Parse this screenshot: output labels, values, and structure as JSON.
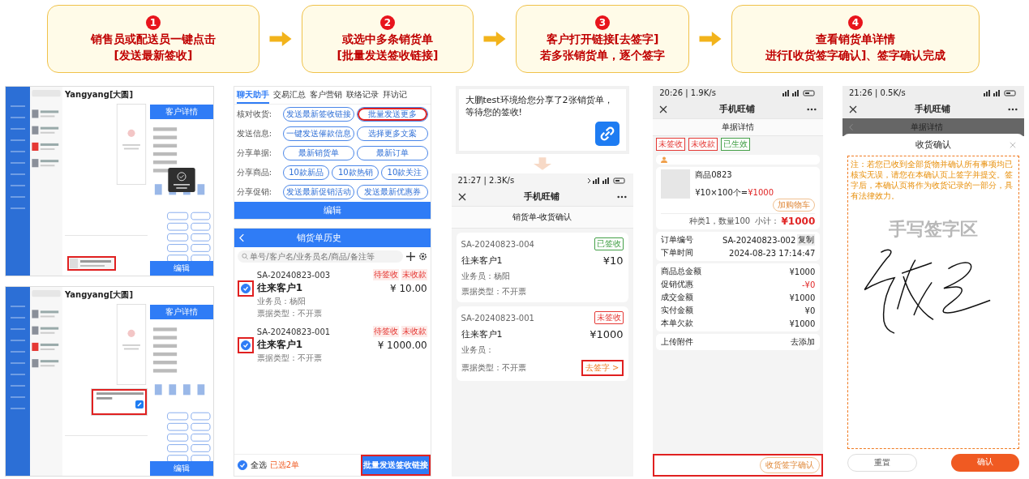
{
  "steps": [
    {
      "number": "1",
      "lines": [
        "销售员或配送员一键点击",
        "[发送最新签收]"
      ]
    },
    {
      "number": "2",
      "lines": [
        "或选中多条销货单",
        "[批量发送签收链接]"
      ]
    },
    {
      "number": "3",
      "lines": [
        "客户打开链接[去签字]",
        "若多张销货单，逐个签字"
      ]
    },
    {
      "number": "4",
      "lines": [
        "查看销货单详情",
        "进行[收货签字确认]、签字确认完成"
      ]
    }
  ],
  "desktop_screens": [
    {
      "chat_title": "Yangyang[大圆]",
      "panel_title": "客户详情",
      "edit_label": "编辑",
      "toast_shown": true,
      "card": {
        "kind": "composer",
        "highlighted": true
      }
    },
    {
      "chat_title": "Yangyang[大圆]",
      "panel_title": "客户详情",
      "edit_label": "编辑",
      "toast_shown": false,
      "card": {
        "kind": "message",
        "highlighted": true
      }
    }
  ],
  "assistant": {
    "tabs": [
      {
        "label": "聊天助手",
        "selected": true
      },
      {
        "label": "交易汇总",
        "selected": false
      },
      {
        "label": "客户营销",
        "selected": false
      },
      {
        "label": "联络记录",
        "selected": false
      },
      {
        "label": "拜访记",
        "selected": false
      }
    ],
    "rows": [
      {
        "label": "核对收货:",
        "buttons": [
          {
            "label": "发送最新签收链接",
            "highlighted": false
          },
          {
            "label": "批量发送更多",
            "highlighted": true
          }
        ]
      },
      {
        "label": "发送信息:",
        "buttons": [
          {
            "label": "一键发送催款信息",
            "highlighted": false
          },
          {
            "label": "选择更多文案",
            "highlighted": false
          }
        ]
      },
      {
        "label": "分享单据:",
        "buttons": [
          {
            "label": "最新销货单",
            "highlighted": false
          },
          {
            "label": "最新订单",
            "highlighted": false
          }
        ]
      },
      {
        "label": "分享商品:",
        "buttons": [
          {
            "label": "10款新品",
            "highlighted": false
          },
          {
            "label": "10款热销",
            "highlighted": false
          },
          {
            "label": "10款关注",
            "highlighted": false
          }
        ]
      },
      {
        "label": "分享促销:",
        "buttons": [
          {
            "label": "发送最新促销活动",
            "highlighted": false
          },
          {
            "label": "发送最新优惠券",
            "highlighted": false
          }
        ]
      }
    ],
    "edit_label": "编辑"
  },
  "history": {
    "title": "销货单历史",
    "search": {
      "placeholder": "单号/客户名/业务员名/商品/备注等"
    },
    "orders": [
      {
        "number": "SA-20240823-003",
        "customer": "往来客户1",
        "amount": "¥ 10.00",
        "details": [
          "业务员：杨阳",
          "票据类型：不开票"
        ],
        "tags": [
          "待签收",
          "未收款"
        ],
        "checked": true,
        "highlighted": true
      },
      {
        "number": "SA-20240823-001",
        "customer": "往来客户1",
        "amount": "¥ 1000.00",
        "details": [
          "票据类型：不开票"
        ],
        "tags": [
          "待签收",
          "未收款"
        ],
        "checked": true,
        "highlighted": true
      }
    ],
    "select_all": {
      "label": "全选",
      "checked": true
    },
    "selected_count": "已选2单",
    "submit": {
      "label": "批量发送签收链接",
      "highlighted": true
    }
  },
  "share_message": {
    "text": "大鹏test环境给您分享了2张销货单，等待您的签收!"
  },
  "confirm_list": {
    "status_time": "21:27 | 2.3K/s",
    "app_title": "手机旺铺",
    "page_title": "销货单-收货确认",
    "orders": [
      {
        "number": "SA-20240823-004",
        "status": {
          "text": "已签收",
          "color": "#43a047"
        },
        "amount": "¥10",
        "customer": "往来客户1",
        "details": [
          "业务员：杨阳",
          "票据类型：不开票"
        ]
      },
      {
        "number": "SA-20240823-001",
        "status": {
          "text": "未签收",
          "color": "#e53935"
        },
        "amount": "¥1000",
        "customer": "往来客户1",
        "details": [
          "业务员：",
          "票据类型：不开票"
        ],
        "action": {
          "label": "去签字 >",
          "highlighted": true
        }
      }
    ]
  },
  "detail": {
    "status_time": "20:26 | 1.9K/s",
    "app_title": "手机旺铺",
    "page_title": "单据详情",
    "tags": [
      {
        "text": "未签收",
        "color": "#e53935"
      },
      {
        "text": "未收款",
        "color": "#e53935"
      },
      {
        "text": "已生效",
        "color": "#43a047"
      }
    ],
    "product": {
      "name": "商品0823",
      "price_formula": "¥10×100个=",
      "price_total": "¥1000",
      "cart_label": "加购物车"
    },
    "summary": "种类1，数量100  小计：",
    "subtotal": "¥1000",
    "info_rows": [
      {
        "label": "订单编号",
        "value": "SA-20240823-002",
        "action": "复制"
      },
      {
        "label": "下单时间",
        "value": "2024-08-23 17:14:47"
      }
    ],
    "amount_rows": [
      {
        "label": "商品总金额",
        "value": "¥1000",
        "kind": "normal"
      },
      {
        "label": "促销优惠",
        "value": "-¥0",
        "kind": "discount"
      },
      {
        "label": "成交金额",
        "value": "¥1000",
        "kind": "normal"
      },
      {
        "label": "实付金额",
        "value": "¥0",
        "kind": "normal"
      },
      {
        "label": "本单欠款",
        "value": "¥1000",
        "kind": "normal"
      }
    ],
    "attachment": {
      "label": "上传附件",
      "action": "去添加"
    },
    "confirm_button": {
      "label": "收货签字确认",
      "highlighted": true
    }
  },
  "signing": {
    "status_time": "21:26 | 0.5K/s",
    "app_title": "手机旺铺",
    "page_title": "单据详情",
    "dialog_title": "收货确认",
    "note": "注：若您已收到全部货物并确认所有事项均已核实无误，请您在本确认页上签字并提交。签字后，本确认页将作为收货记录的一部分，具有法律效力。",
    "signature_area_label": "手写签字区",
    "buttons": [
      {
        "label": "重置",
        "kind": "secondary"
      },
      {
        "label": "确认",
        "kind": "primary"
      }
    ]
  }
}
